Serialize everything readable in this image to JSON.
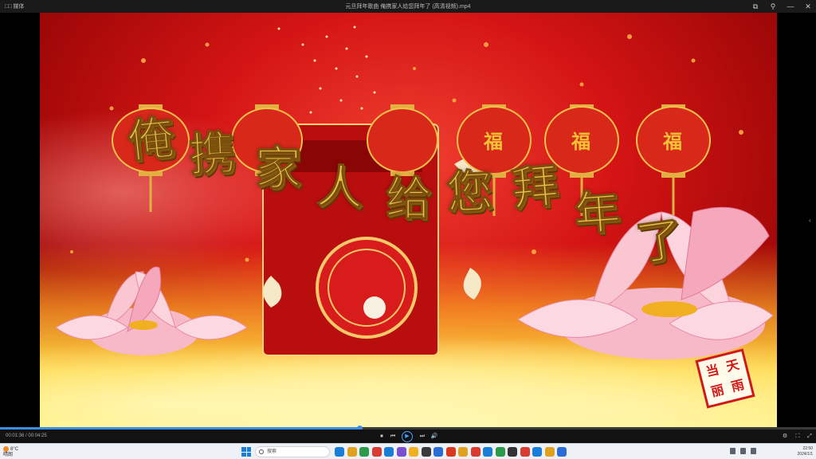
{
  "window": {
    "app_label": "□□ 媒体",
    "title": "元旦拜年歌曲 俺携家人给您拜年了 (高清视频).mp4",
    "controls": [
      "⧉",
      "⚲",
      "—",
      "✕"
    ]
  },
  "video": {
    "greeting": [
      "俺",
      "携",
      "家",
      "人",
      "给",
      "您",
      "拜",
      "年",
      "了"
    ],
    "lantern_text": "福",
    "seal_text": [
      "当",
      "天",
      "丽",
      "雨"
    ],
    "colors": {
      "gold": "#e9c24a",
      "red": "#d41414",
      "yellow": "#ffd640"
    }
  },
  "player": {
    "time": "00:01:36 / 00:04:25",
    "progress": 0.44,
    "buttons": [
      "⏹",
      "⏮",
      "▶",
      "⏭",
      "🔊"
    ],
    "right_buttons": [
      "⚙",
      "⛶",
      "⤢"
    ]
  },
  "taskbar": {
    "weather_temp": "8°C",
    "weather_desc": "晴朗",
    "search_placeholder": "搜索",
    "clock_time": "22:50",
    "clock_date": "2024/1/1",
    "app_icon_colors": [
      "#1a7ed6",
      "#e0a020",
      "#2d9a4a",
      "#d83b2f",
      "#1a7ed6",
      "#7a4fd0",
      "#f0b020",
      "#3a3a3a",
      "#2b6cd6",
      "#d8391f",
      "#e0a020",
      "#d83b2f",
      "#1a7ed6",
      "#2d9a4a",
      "#333333",
      "#d83b2f",
      "#1a7ed6",
      "#e0a020",
      "#2b6cd6"
    ]
  }
}
